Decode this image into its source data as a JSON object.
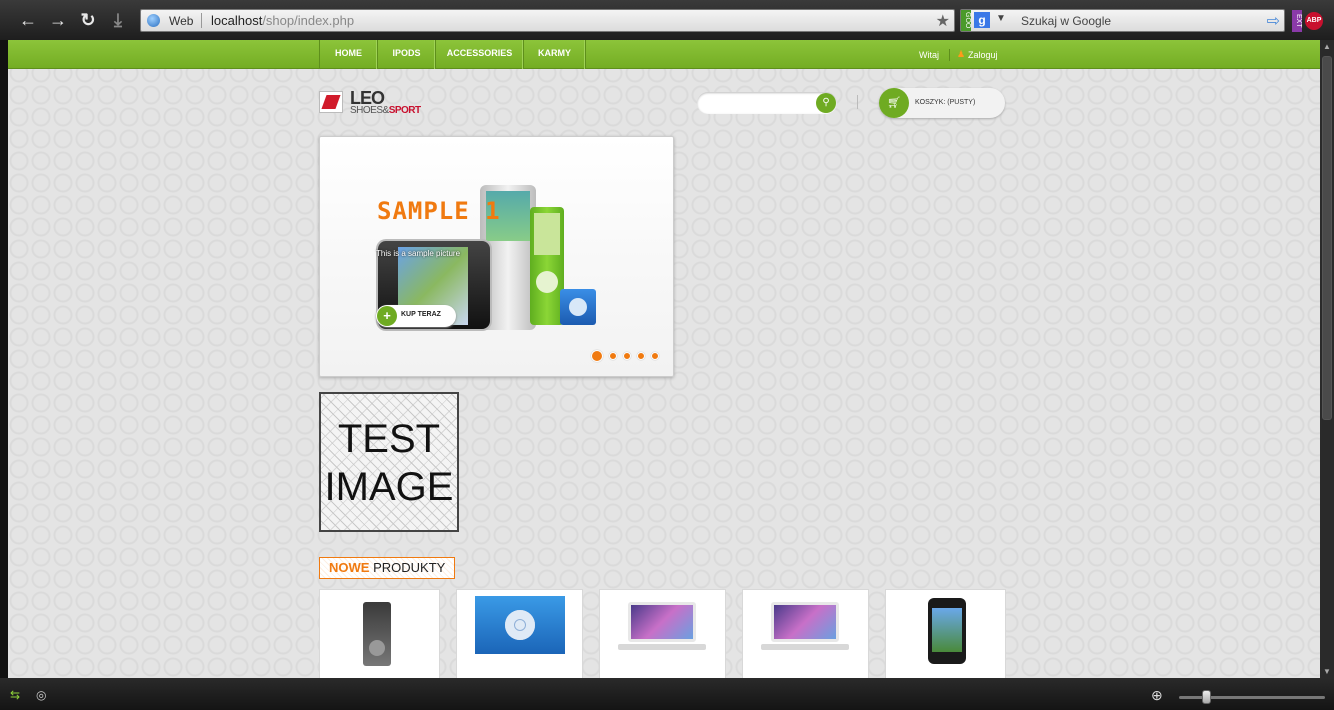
{
  "browser": {
    "url_label": "Web",
    "url_host": "localhost",
    "url_path": "/shop/index.php",
    "search_placeholder": "Szukaj w Google",
    "search_engine_tag": "GOO",
    "ext_tag": "EXT",
    "adblock_label": "ABP",
    "zoom_level": 0.17
  },
  "topbar": {
    "menu": [
      "HOME",
      "IPODS",
      "ACCESSORIES",
      "KARMY"
    ],
    "welcome": "Witaj",
    "login": "Zaloguj"
  },
  "header": {
    "logo_main": "LEO",
    "logo_sub1": "SHOES",
    "logo_amp": "&",
    "logo_sub2": "SPORT",
    "cart_label": "KOSZYK: (PUSTY)"
  },
  "slider": {
    "title": "SAMPLE 1",
    "caption": "This is a sample picture",
    "buy_label": "KUP TERAZ",
    "slide_count": 5,
    "active_slide": 1
  },
  "banner": {
    "line1": "TEST",
    "line2": "IMAGE"
  },
  "new_products": {
    "title_highlight": "NOWE",
    "title_rest": "PRODUKTY"
  },
  "colors": {
    "accent_green": "#7ab62c",
    "accent_orange": "#f07a10"
  }
}
